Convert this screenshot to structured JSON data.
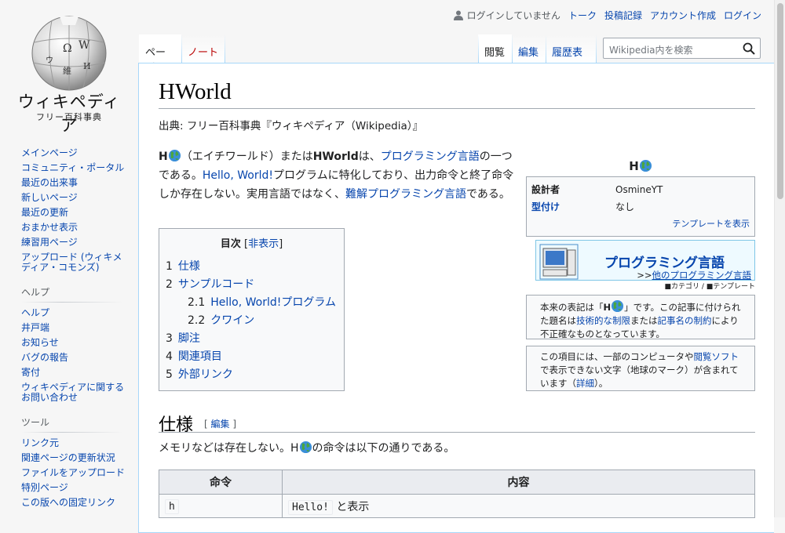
{
  "logo": {
    "wordmark": "ウィキペディア",
    "tagline": "フリー百科事典"
  },
  "sidebar": {
    "nav": [
      {
        "label": "メインページ"
      },
      {
        "label": "コミュニティ・ポータル"
      },
      {
        "label": "最近の出来事"
      },
      {
        "label": "新しいページ"
      },
      {
        "label": "最近の更新"
      },
      {
        "label": "おまかせ表示"
      },
      {
        "label": "練習用ページ"
      },
      {
        "label": "アップロード (ウィキメディア・コモンズ)"
      }
    ],
    "help_heading": "ヘルプ",
    "help": [
      {
        "label": "ヘルプ"
      },
      {
        "label": "井戸端"
      },
      {
        "label": "お知らせ"
      },
      {
        "label": "バグの報告"
      },
      {
        "label": "寄付"
      },
      {
        "label": "ウィキペディアに関するお問い合わせ"
      }
    ],
    "tools_heading": "ツール",
    "tools": [
      {
        "label": "リンク元"
      },
      {
        "label": "関連ページの更新状況"
      },
      {
        "label": "ファイルをアップロード"
      },
      {
        "label": "特別ページ"
      },
      {
        "label": "この版への固定リンク"
      }
    ]
  },
  "personal": {
    "not_logged_in": "ログインしていません",
    "talk": "トーク",
    "contributions": "投稿記録",
    "create_account": "アカウント作成",
    "login": "ログイン"
  },
  "tabs": {
    "page": "ページ",
    "talk": "ノート",
    "read": "閲覧",
    "edit": "編集",
    "history": "履歴表示"
  },
  "search": {
    "placeholder": "Wikipedia内を検索"
  },
  "article": {
    "title": "HWorld",
    "from": "出典: フリー百科事典『ウィキペディア（Wikipedia）』",
    "lead": {
      "h": "H",
      "p1": "（エイチワールド）または",
      "bold_name": "HWorld",
      "p2": "は、",
      "link_pl": "プログラミング言語",
      "p3": "の一つである。",
      "link_hello": "Hello, World!",
      "p4": "プログラムに特化しており、出力命令と終了命令しか存在しない。実用言語ではなく、",
      "link_esoteric": "難解プログラミング言語",
      "p5": "である。"
    },
    "toc": {
      "title": "目次",
      "toggle": "非表示",
      "items": [
        {
          "num": "1",
          "label": "仕様"
        },
        {
          "num": "2",
          "label": "サンプルコード"
        },
        {
          "num": "2.1",
          "label": "Hello, World!プログラム"
        },
        {
          "num": "2.2",
          "label": "クワイン"
        },
        {
          "num": "3",
          "label": "脚注"
        },
        {
          "num": "4",
          "label": "関連項目"
        },
        {
          "num": "5",
          "label": "外部リンク"
        }
      ]
    },
    "infobox": {
      "title": "H",
      "rows": [
        {
          "key": "設計者",
          "value": "OsmineYT"
        },
        {
          "key": "型付け",
          "value": "なし"
        }
      ],
      "template_link": "テンプレートを表示"
    },
    "portal": {
      "title": "プログラミング言語",
      "more": "他のプログラミング言語",
      "more_prefix": ">>",
      "nav_category": "■カテゴリ",
      "nav_sep": " / ",
      "nav_template": "■テンプレート"
    },
    "note1": {
      "t1": "本来の表記は「",
      "t2": "H",
      "t3": "」です。この記事に付けられた題名は",
      "link1": "技術的な制限",
      "t4": "または",
      "link2": "記事名の制約",
      "t5": "により不正確なものとなっています。"
    },
    "note2": {
      "t1": "この項目には、一部のコンピュータや",
      "link1": "閲覧ソフト",
      "t2": "で表示できない文字（地球のマーク）が含まれています（",
      "link2": "詳細",
      "t3": "）。"
    },
    "section": {
      "heading": "仕様",
      "edit_link": "編集",
      "text1": "メモリなどは存在しない。H",
      "text2": "の命令は以下の通りである。"
    },
    "table": {
      "headers": [
        "命令",
        "内容"
      ],
      "rows": [
        {
          "cmd": "h",
          "desc_code": "Hello!",
          "desc": "と表示"
        }
      ]
    }
  }
}
